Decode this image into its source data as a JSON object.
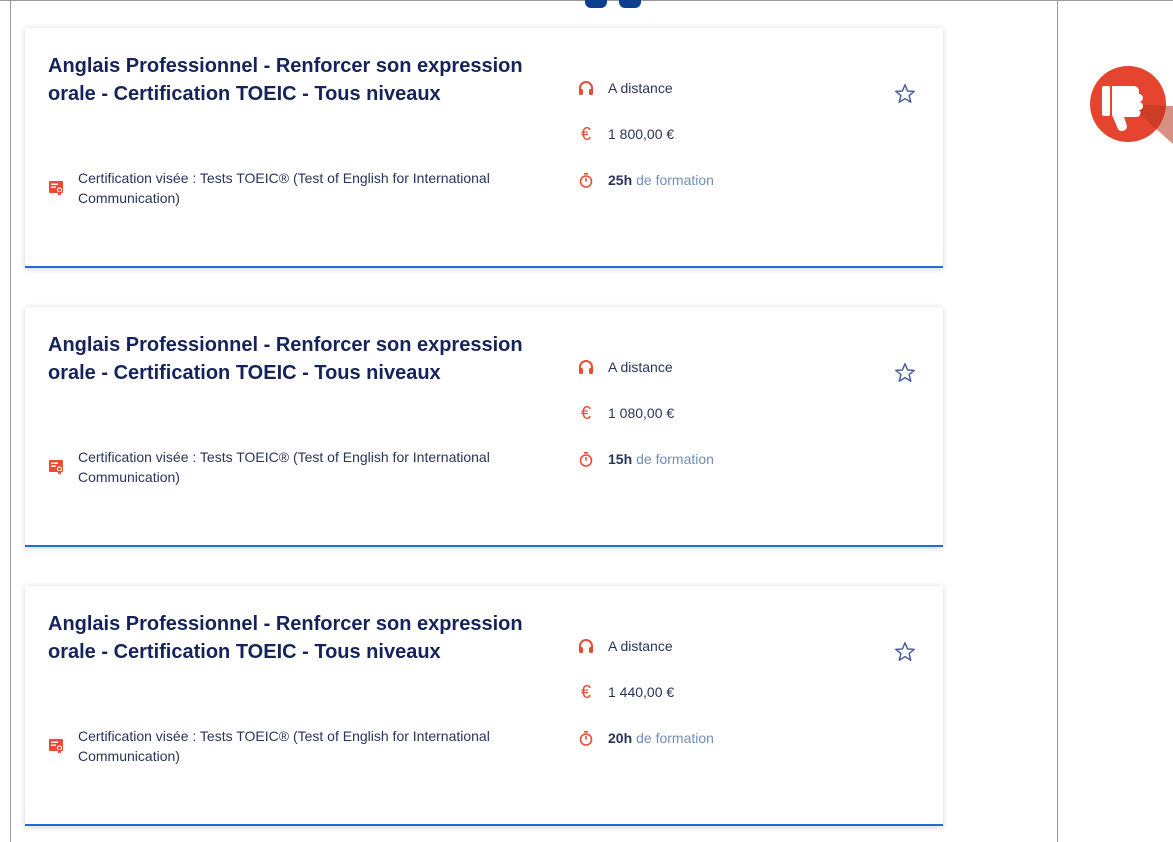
{
  "cards": [
    {
      "title": "Anglais Professionnel - Renforcer son expression orale - Certification TOEIC - Tous niveaux",
      "certification": "Certification visée : Tests TOEIC® (Test of English for International Communication)",
      "modality": "A distance",
      "price": "1 800,00 €",
      "duration_value": "25h",
      "duration_suffix": "de formation"
    },
    {
      "title": "Anglais Professionnel - Renforcer son expression orale - Certification TOEIC - Tous niveaux",
      "certification": "Certification visée : Tests TOEIC® (Test of English for International Communication)",
      "modality": "A distance",
      "price": "1 080,00 €",
      "duration_value": "15h",
      "duration_suffix": "de formation"
    },
    {
      "title": "Anglais Professionnel - Renforcer son expression orale - Certification TOEIC - Tous niveaux",
      "certification": "Certification visée : Tests TOEIC® (Test of English for International Communication)",
      "modality": "A distance",
      "price": "1 440,00 €",
      "duration_value": "20h",
      "duration_suffix": "de formation"
    }
  ],
  "icons": {
    "modality": "headphones-icon",
    "price": "euro-icon",
    "duration": "stopwatch-icon",
    "certification": "certificate-icon",
    "favorite": "star-outline-icon",
    "badge": "thumbs-down-icon"
  },
  "colors": {
    "title": "#16235a",
    "accent_red": "#e84c36",
    "card_border": "#1f6fd1",
    "muted_blue": "#6f8fbd"
  }
}
